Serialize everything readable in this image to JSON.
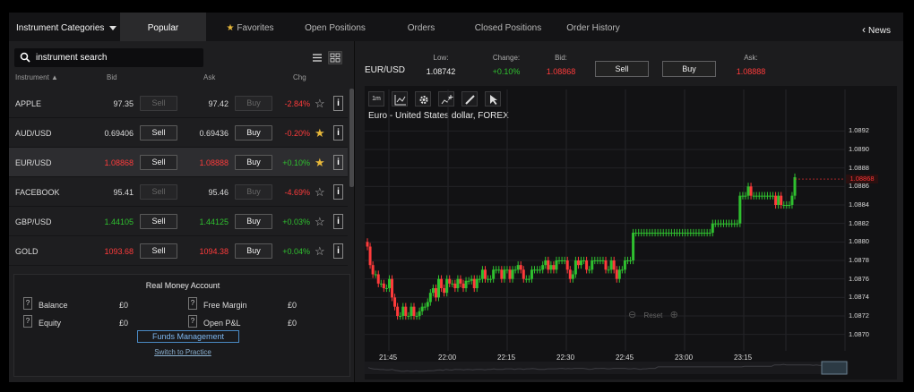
{
  "colors": {
    "up": "#2fc02f",
    "down": "#ff3b3b",
    "star": "#e8b83a",
    "accent": "#4a8ac4"
  },
  "nav": {
    "categories": "Instrument Categories",
    "tabs": [
      {
        "label": "Popular"
      },
      {
        "label": "Favorites"
      },
      {
        "label": "Open Positions"
      },
      {
        "label": "Orders"
      },
      {
        "label": "Closed Positions"
      },
      {
        "label": "Order History"
      }
    ],
    "news": "News"
  },
  "search": {
    "placeholder": "instrument search"
  },
  "columns": {
    "instrument": "Instrument",
    "bid": "Bid",
    "ask": "Ask",
    "chg": "Chg"
  },
  "instruments": [
    {
      "name": "APPLE",
      "bid": "97.35",
      "bid_dir": "flat",
      "ask": "97.42",
      "ask_dir": "flat",
      "sell": "Sell",
      "buy": "Buy",
      "enabled": false,
      "chg": "-2.84%",
      "chg_dir": "down",
      "fav": false
    },
    {
      "name": "AUD/USD",
      "bid": "0.69406",
      "bid_dir": "flat",
      "ask": "0.69436",
      "ask_dir": "flat",
      "sell": "Sell",
      "buy": "Buy",
      "enabled": true,
      "chg": "-0.20%",
      "chg_dir": "down",
      "fav": true
    },
    {
      "name": "EUR/USD",
      "bid": "1.08868",
      "bid_dir": "down",
      "ask": "1.08888",
      "ask_dir": "down",
      "sell": "Sell",
      "buy": "Buy",
      "enabled": true,
      "chg": "+0.10%",
      "chg_dir": "up",
      "fav": true
    },
    {
      "name": "FACEBOOK",
      "bid": "95.41",
      "bid_dir": "flat",
      "ask": "95.46",
      "ask_dir": "flat",
      "sell": "Sell",
      "buy": "Buy",
      "enabled": false,
      "chg": "-4.69%",
      "chg_dir": "down",
      "fav": false
    },
    {
      "name": "GBP/USD",
      "bid": "1.44105",
      "bid_dir": "up",
      "ask": "1.44125",
      "ask_dir": "up",
      "sell": "Sell",
      "buy": "Buy",
      "enabled": true,
      "chg": "+0.03%",
      "chg_dir": "up",
      "fav": false
    },
    {
      "name": "GOLD",
      "bid": "1093.68",
      "bid_dir": "down",
      "ask": "1094.38",
      "ask_dir": "down",
      "sell": "Sell",
      "buy": "Buy",
      "enabled": true,
      "chg": "+0.04%",
      "chg_dir": "up",
      "fav": false
    }
  ],
  "account": {
    "title": "Real Money Account",
    "balance_label": "Balance",
    "balance": "£0",
    "equity_label": "Equity",
    "equity": "£0",
    "free_margin_label": "Free Margin",
    "free_margin": "£0",
    "pnl_label": "Open P&L",
    "pnl": "£0",
    "funds": "Funds Management",
    "practice": "Switch to Practice"
  },
  "quote": {
    "symbol": "EUR/USD",
    "low_label": "Low:",
    "low": "1.08742",
    "change_label": "Change:",
    "change": "+0.10%",
    "bid_label": "Bid:",
    "bid": "1.08868",
    "ask_label": "Ask:",
    "ask": "1.08888",
    "sell": "Sell",
    "buy": "Buy"
  },
  "chart": {
    "title": "Euro - United States dollar, FOREX",
    "timeframe": "1m",
    "current_price": "1.08868",
    "reset": "Reset"
  },
  "chart_data": {
    "type": "candlestick",
    "y_ticks": [
      "1.0892",
      "1.0890",
      "1.0888",
      "1.0886",
      "1.0884",
      "1.0882",
      "1.0880",
      "1.0878",
      "1.0876",
      "1.0874",
      "1.0872",
      "1.0870"
    ],
    "x_ticks": [
      "21:45",
      "22:00",
      "22:15",
      "22:30",
      "22:45",
      "23:00",
      "23:15"
    ],
    "ylim": [
      1.0869,
      1.0893
    ],
    "grid": true,
    "current": 1.08868,
    "close": [
      1.08795,
      1.08775,
      1.08765,
      1.08765,
      1.08755,
      1.08755,
      1.0875,
      1.0875,
      1.0876,
      1.0874,
      1.0873,
      1.0872,
      1.0872,
      1.0873,
      1.0872,
      1.0872,
      1.0873,
      1.0872,
      1.0872,
      1.08725,
      1.0873,
      1.0873,
      1.08735,
      1.08745,
      1.0875,
      1.0874,
      1.0876,
      1.0875,
      1.08745,
      1.0876,
      1.08755,
      1.08755,
      1.0875,
      1.0876,
      1.08755,
      1.0875,
      1.08758,
      1.08758,
      1.0876,
      1.0875,
      1.0876,
      1.0876,
      1.0877,
      1.0876,
      1.0876,
      1.0876,
      1.0877,
      1.0877,
      1.0877,
      1.0876,
      1.0877,
      1.0877,
      1.0876,
      1.0877,
      1.0877,
      1.08775,
      1.0877,
      1.0876,
      1.0876,
      1.0876,
      1.0877,
      1.0877,
      1.0877,
      1.0877,
      1.08775,
      1.0878,
      1.0877,
      1.08775,
      1.0877,
      1.0878,
      1.0878,
      1.0878,
      1.0878,
      1.0877,
      1.0876,
      1.08765,
      1.0878,
      1.08775,
      1.0878,
      1.0878,
      1.0877,
      1.0877,
      1.0878,
      1.0878,
      1.0878,
      1.0878,
      1.0878,
      1.0877,
      1.0877,
      1.0878,
      1.0877,
      1.0876,
      1.0877,
      1.0877,
      1.0878,
      1.0878,
      1.0878,
      1.0881,
      1.0881,
      1.0881,
      1.0881,
      1.0881,
      1.0881,
      1.0881,
      1.0881,
      1.0881,
      1.0881,
      1.0881,
      1.0881,
      1.0881,
      1.0881,
      1.0881,
      1.0881,
      1.0881,
      1.0881,
      1.0881,
      1.0881,
      1.0881,
      1.0881,
      1.0881,
      1.0881,
      1.0881,
      1.0881,
      1.0881,
      1.0881,
      1.0881,
      1.0882,
      1.0882,
      1.0882,
      1.0882,
      1.0882,
      1.0882,
      1.0882,
      1.0882,
      1.0882,
      1.0882,
      1.0885,
      1.0885,
      1.0885,
      1.0886,
      1.0885,
      1.0885,
      1.0885,
      1.0885,
      1.0885,
      1.0885,
      1.0885,
      1.0885,
      1.0885,
      1.0884,
      1.0885,
      1.0884,
      1.0884,
      1.0884,
      1.0884,
      1.0885,
      1.0887
    ]
  }
}
